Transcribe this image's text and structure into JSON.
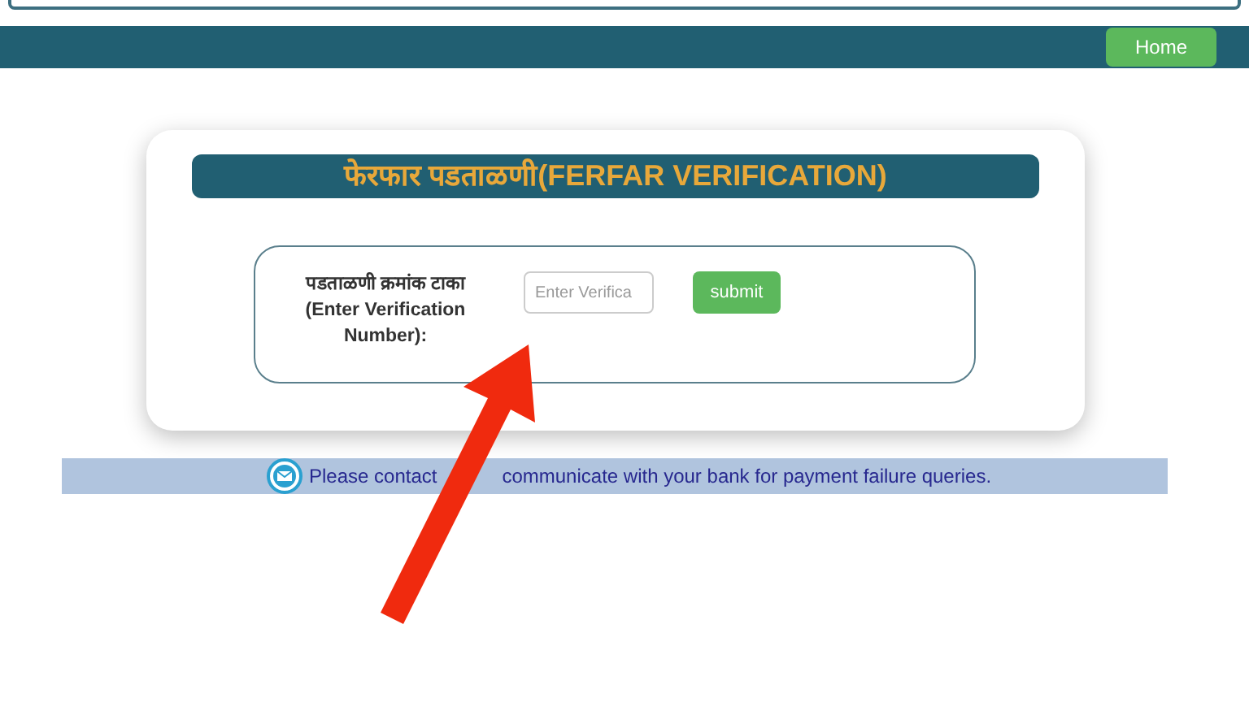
{
  "navbar": {
    "home_button": "Home"
  },
  "title": "फेरफार पडताळणी(FERFAR VERIFICATION)",
  "form": {
    "label": "पडताळणी क्रमांक टाका (Enter Verification Number):",
    "input": {
      "placeholder": "Enter Verifica"
    },
    "submit": "submit"
  },
  "notice": {
    "text_before": "Please contact",
    "text_after": "communicate with your bank for payment failure queries."
  }
}
